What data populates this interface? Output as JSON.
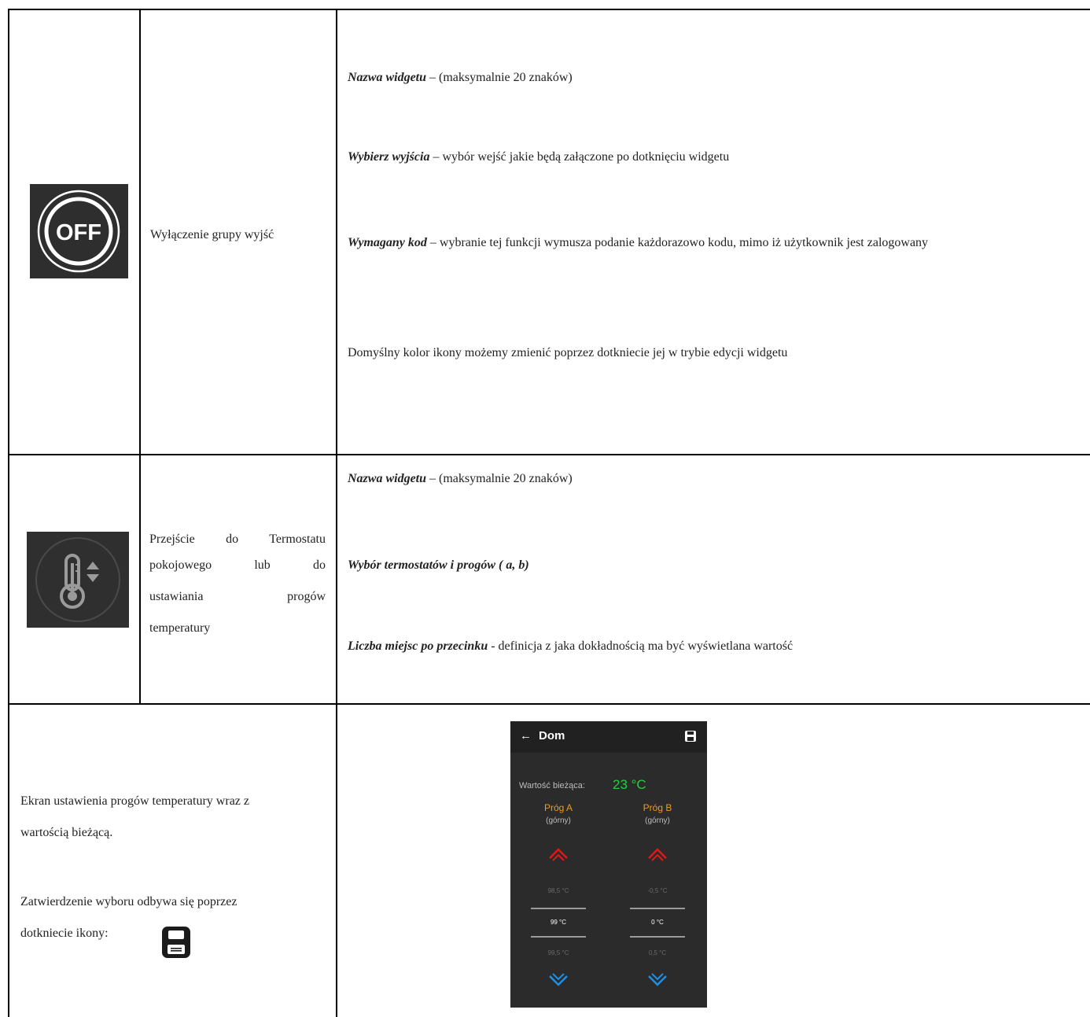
{
  "rows": [
    {
      "icon": "off-icon",
      "name": "Wyłączenie grupy wyjść",
      "details": [
        {
          "label": "Nazwa widgetu",
          "text": " – (maksymalnie 20 znaków)"
        },
        {
          "label": "Wybierz wyjścia",
          "text": " – wybór wejść jakie będą załączone po dotknięciu widgetu"
        },
        {
          "label": "Wymagany kod",
          "text": " – wybranie tej funkcji wymusza podanie każdorazowo kodu, mimo iż użytkownik jest zalogowany"
        },
        {
          "label": "",
          "text": "Domyślny kolor ikony możemy zmienić poprzez dotkniecie jej w trybie edycji widgetu"
        }
      ]
    },
    {
      "icon": "thermometer-icon",
      "name": "Przejście do Termostatu pokojowego lub do ustawiania progów temperatury",
      "name_lines": [
        "Przejście do Termostatu",
        "pokojowego lub do",
        "ustawiania progów",
        "temperatury"
      ],
      "details": [
        {
          "label": "Nazwa widgetu",
          "text": " – (maksymalnie 20 znaków)"
        },
        {
          "label": "Wybór termostatów i progów ( a, b)",
          "text": ""
        },
        {
          "label": "Liczba miejsc po przecinku",
          "text": " - definicja z jaka dokładnością ma być wyświetlana wartość"
        }
      ]
    }
  ],
  "bottom": {
    "desc_lines": [
      "Ekran ustawienia progów temperatury wraz z",
      "wartością bieżącą."
    ],
    "confirm_lines": [
      "Zatwierdzenie wyboru odbywa się poprzez",
      "dotkniecie ikony:"
    ],
    "save_icon": "save-icon"
  },
  "phone": {
    "back": "←",
    "title": "Dom",
    "current_label": "Wartość bieżąca:",
    "current_value": "23 °C",
    "columns": [
      {
        "title": "Próg A",
        "sub": "(górny)",
        "prev": "98,5 °C",
        "value": "99 °C",
        "next": "99,5 °C"
      },
      {
        "title": "Próg B",
        "sub": "(górny)",
        "prev": "-0,5 °C",
        "value": "0 °C",
        "next": "0,5 °C"
      }
    ],
    "colors": {
      "up": "#e01818",
      "down": "#1e8fe6",
      "current": "#22d13a",
      "threshold": "#f39a1d"
    }
  }
}
